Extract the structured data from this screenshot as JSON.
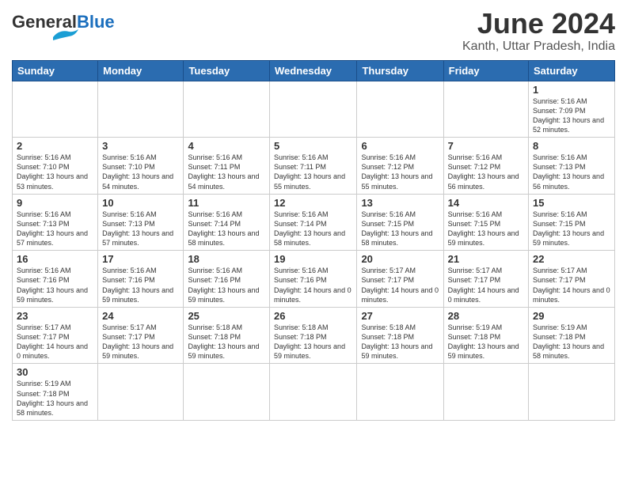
{
  "logo": {
    "general": "General",
    "blue": "Blue",
    "wing_color": "#1a9ed4"
  },
  "header": {
    "title": "June 2024",
    "subtitle": "Kanth, Uttar Pradesh, India"
  },
  "weekdays": [
    "Sunday",
    "Monday",
    "Tuesday",
    "Wednesday",
    "Thursday",
    "Friday",
    "Saturday"
  ],
  "days": {
    "d1": {
      "num": "1",
      "sunrise": "Sunrise: 5:16 AM",
      "sunset": "Sunset: 7:09 PM",
      "daylight": "Daylight: 13 hours and 52 minutes."
    },
    "d2": {
      "num": "2",
      "sunrise": "Sunrise: 5:16 AM",
      "sunset": "Sunset: 7:10 PM",
      "daylight": "Daylight: 13 hours and 53 minutes."
    },
    "d3": {
      "num": "3",
      "sunrise": "Sunrise: 5:16 AM",
      "sunset": "Sunset: 7:10 PM",
      "daylight": "Daylight: 13 hours and 54 minutes."
    },
    "d4": {
      "num": "4",
      "sunrise": "Sunrise: 5:16 AM",
      "sunset": "Sunset: 7:11 PM",
      "daylight": "Daylight: 13 hours and 54 minutes."
    },
    "d5": {
      "num": "5",
      "sunrise": "Sunrise: 5:16 AM",
      "sunset": "Sunset: 7:11 PM",
      "daylight": "Daylight: 13 hours and 55 minutes."
    },
    "d6": {
      "num": "6",
      "sunrise": "Sunrise: 5:16 AM",
      "sunset": "Sunset: 7:12 PM",
      "daylight": "Daylight: 13 hours and 55 minutes."
    },
    "d7": {
      "num": "7",
      "sunrise": "Sunrise: 5:16 AM",
      "sunset": "Sunset: 7:12 PM",
      "daylight": "Daylight: 13 hours and 56 minutes."
    },
    "d8": {
      "num": "8",
      "sunrise": "Sunrise: 5:16 AM",
      "sunset": "Sunset: 7:13 PM",
      "daylight": "Daylight: 13 hours and 56 minutes."
    },
    "d9": {
      "num": "9",
      "sunrise": "Sunrise: 5:16 AM",
      "sunset": "Sunset: 7:13 PM",
      "daylight": "Daylight: 13 hours and 57 minutes."
    },
    "d10": {
      "num": "10",
      "sunrise": "Sunrise: 5:16 AM",
      "sunset": "Sunset: 7:13 PM",
      "daylight": "Daylight: 13 hours and 57 minutes."
    },
    "d11": {
      "num": "11",
      "sunrise": "Sunrise: 5:16 AM",
      "sunset": "Sunset: 7:14 PM",
      "daylight": "Daylight: 13 hours and 58 minutes."
    },
    "d12": {
      "num": "12",
      "sunrise": "Sunrise: 5:16 AM",
      "sunset": "Sunset: 7:14 PM",
      "daylight": "Daylight: 13 hours and 58 minutes."
    },
    "d13": {
      "num": "13",
      "sunrise": "Sunrise: 5:16 AM",
      "sunset": "Sunset: 7:15 PM",
      "daylight": "Daylight: 13 hours and 58 minutes."
    },
    "d14": {
      "num": "14",
      "sunrise": "Sunrise: 5:16 AM",
      "sunset": "Sunset: 7:15 PM",
      "daylight": "Daylight: 13 hours and 59 minutes."
    },
    "d15": {
      "num": "15",
      "sunrise": "Sunrise: 5:16 AM",
      "sunset": "Sunset: 7:15 PM",
      "daylight": "Daylight: 13 hours and 59 minutes."
    },
    "d16": {
      "num": "16",
      "sunrise": "Sunrise: 5:16 AM",
      "sunset": "Sunset: 7:16 PM",
      "daylight": "Daylight: 13 hours and 59 minutes."
    },
    "d17": {
      "num": "17",
      "sunrise": "Sunrise: 5:16 AM",
      "sunset": "Sunset: 7:16 PM",
      "daylight": "Daylight: 13 hours and 59 minutes."
    },
    "d18": {
      "num": "18",
      "sunrise": "Sunrise: 5:16 AM",
      "sunset": "Sunset: 7:16 PM",
      "daylight": "Daylight: 13 hours and 59 minutes."
    },
    "d19": {
      "num": "19",
      "sunrise": "Sunrise: 5:16 AM",
      "sunset": "Sunset: 7:16 PM",
      "daylight": "Daylight: 14 hours and 0 minutes."
    },
    "d20": {
      "num": "20",
      "sunrise": "Sunrise: 5:17 AM",
      "sunset": "Sunset: 7:17 PM",
      "daylight": "Daylight: 14 hours and 0 minutes."
    },
    "d21": {
      "num": "21",
      "sunrise": "Sunrise: 5:17 AM",
      "sunset": "Sunset: 7:17 PM",
      "daylight": "Daylight: 14 hours and 0 minutes."
    },
    "d22": {
      "num": "22",
      "sunrise": "Sunrise: 5:17 AM",
      "sunset": "Sunset: 7:17 PM",
      "daylight": "Daylight: 14 hours and 0 minutes."
    },
    "d23": {
      "num": "23",
      "sunrise": "Sunrise: 5:17 AM",
      "sunset": "Sunset: 7:17 PM",
      "daylight": "Daylight: 14 hours and 0 minutes."
    },
    "d24": {
      "num": "24",
      "sunrise": "Sunrise: 5:17 AM",
      "sunset": "Sunset: 7:17 PM",
      "daylight": "Daylight: 13 hours and 59 minutes."
    },
    "d25": {
      "num": "25",
      "sunrise": "Sunrise: 5:18 AM",
      "sunset": "Sunset: 7:18 PM",
      "daylight": "Daylight: 13 hours and 59 minutes."
    },
    "d26": {
      "num": "26",
      "sunrise": "Sunrise: 5:18 AM",
      "sunset": "Sunset: 7:18 PM",
      "daylight": "Daylight: 13 hours and 59 minutes."
    },
    "d27": {
      "num": "27",
      "sunrise": "Sunrise: 5:18 AM",
      "sunset": "Sunset: 7:18 PM",
      "daylight": "Daylight: 13 hours and 59 minutes."
    },
    "d28": {
      "num": "28",
      "sunrise": "Sunrise: 5:19 AM",
      "sunset": "Sunset: 7:18 PM",
      "daylight": "Daylight: 13 hours and 59 minutes."
    },
    "d29": {
      "num": "29",
      "sunrise": "Sunrise: 5:19 AM",
      "sunset": "Sunset: 7:18 PM",
      "daylight": "Daylight: 13 hours and 58 minutes."
    },
    "d30": {
      "num": "30",
      "sunrise": "Sunrise: 5:19 AM",
      "sunset": "Sunset: 7:18 PM",
      "daylight": "Daylight: 13 hours and 58 minutes."
    }
  }
}
